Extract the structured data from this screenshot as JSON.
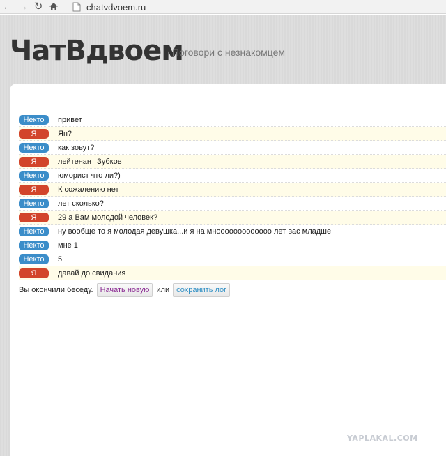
{
  "browser": {
    "url": "chatvdvoem.ru"
  },
  "site": {
    "title": "ЧатВдвоем",
    "tagline": "Поговори с незнакомцем"
  },
  "chat": {
    "messages": [
      {
        "sender": "Некто",
        "role": "stranger",
        "text": "привет"
      },
      {
        "sender": "Я",
        "role": "me",
        "text": "Яп?"
      },
      {
        "sender": "Некто",
        "role": "stranger",
        "text": "как зовут?"
      },
      {
        "sender": "Я",
        "role": "me",
        "text": "лейтенант Зубков"
      },
      {
        "sender": "Некто",
        "role": "stranger",
        "text": "юморист что ли?)"
      },
      {
        "sender": "Я",
        "role": "me",
        "text": "К сожалению нет"
      },
      {
        "sender": "Некто",
        "role": "stranger",
        "text": "лет сколько?"
      },
      {
        "sender": "Я",
        "role": "me",
        "text": "29 а Вам молодой человек?"
      },
      {
        "sender": "Некто",
        "role": "stranger",
        "text": "ну вообще то я молодая девушка...и я на мнооооооооооооо лет вас младше"
      },
      {
        "sender": "Некто",
        "role": "stranger",
        "text": "мне 1"
      },
      {
        "sender": "Некто",
        "role": "stranger",
        "text": "5"
      },
      {
        "sender": "Я",
        "role": "me",
        "text": "давай до свидания"
      }
    ],
    "end_text": "Вы окончили беседу.",
    "new_button": "Начать новую",
    "or_text": "или",
    "save_button": "сохранить лог"
  },
  "watermark": "YAPLAKAL.COM",
  "colors": {
    "stranger_badge": "#3b8dc9",
    "me_badge": "#d2452b",
    "me_row_bg": "#fffce8"
  }
}
